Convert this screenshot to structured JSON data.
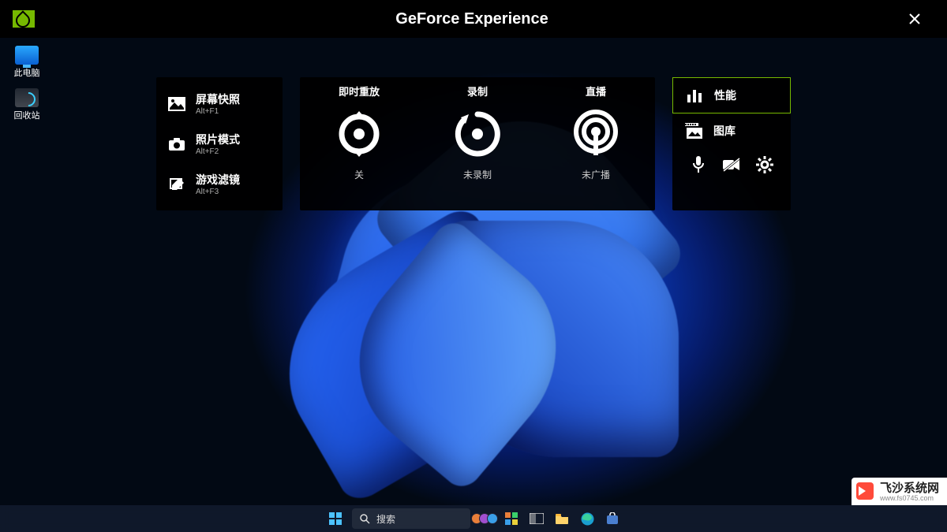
{
  "app": {
    "title": "GeForce Experience"
  },
  "desktop": {
    "icons": [
      {
        "label": "此电脑"
      },
      {
        "label": "回收站"
      }
    ]
  },
  "left": {
    "items": [
      {
        "label": "屏幕快照",
        "shortcut": "Alt+F1"
      },
      {
        "label": "照片模式",
        "shortcut": "Alt+F2"
      },
      {
        "label": "游戏滤镜",
        "shortcut": "Alt+F3"
      }
    ]
  },
  "center": {
    "cols": [
      {
        "title": "即时重放",
        "status": "关"
      },
      {
        "title": "录制",
        "status": "未录制"
      },
      {
        "title": "直播",
        "status": "未广播"
      }
    ]
  },
  "right": {
    "items": [
      {
        "label": "性能",
        "selected": true
      },
      {
        "label": "图库",
        "selected": false
      }
    ]
  },
  "taskbar": {
    "search_placeholder": "搜索"
  },
  "watermark": {
    "name": "飞沙系统网",
    "url": "www.fs0745.com"
  }
}
